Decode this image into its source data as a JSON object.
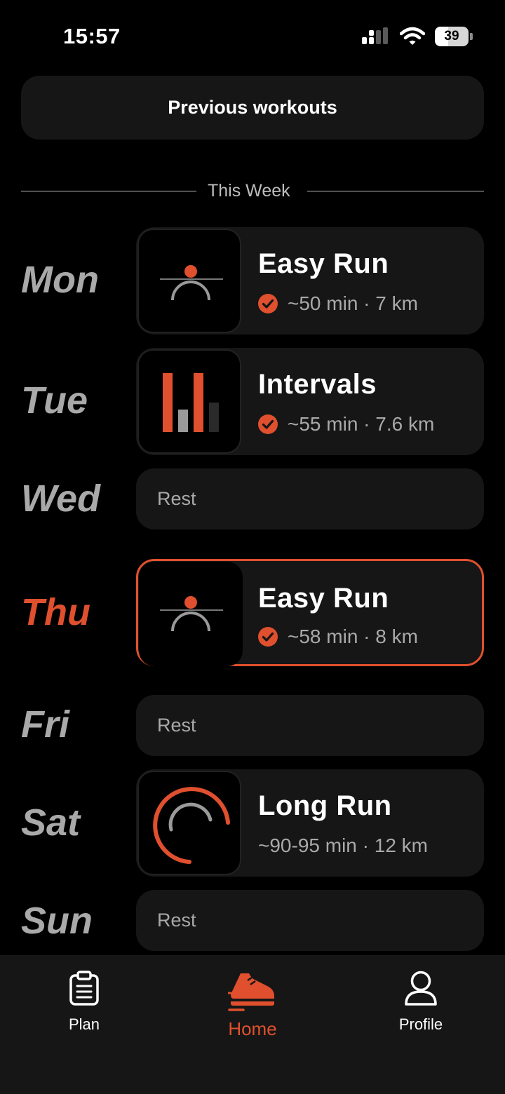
{
  "status": {
    "time": "15:57",
    "battery": "39",
    "battery_level": 0.39
  },
  "previous_button": "Previous workouts",
  "week_label": "This Week",
  "days": [
    {
      "day": "Mon",
      "type": "workout",
      "title": "Easy Run",
      "meta": "~50 min · 7 km",
      "completed": true,
      "icon": "easy-run-icon"
    },
    {
      "day": "Tue",
      "type": "workout",
      "title": "Intervals",
      "meta": "~55 min · 7.6 km",
      "completed": true,
      "icon": "intervals-icon"
    },
    {
      "day": "Wed",
      "type": "rest",
      "title": "Rest"
    },
    {
      "day": "Thu",
      "type": "workout",
      "title": "Easy Run",
      "meta": "~58 min · 8 km",
      "completed": true,
      "icon": "easy-run-icon",
      "today": true
    },
    {
      "day": "Fri",
      "type": "rest",
      "title": "Rest"
    },
    {
      "day": "Sat",
      "type": "workout",
      "title": "Long Run",
      "meta": "~90-95 min · 12 km",
      "completed": false,
      "icon": "long-run-icon"
    },
    {
      "day": "Sun",
      "type": "rest",
      "title": "Rest"
    }
  ],
  "tabs": [
    {
      "label": "Plan",
      "icon": "clipboard-icon"
    },
    {
      "label": "Home",
      "icon": "running-shoe-icon",
      "active": true
    },
    {
      "label": "Profile",
      "icon": "user-icon"
    }
  ],
  "colors": {
    "accent": "#e0502e",
    "card": "#161616",
    "muted": "#a9a9a9"
  }
}
